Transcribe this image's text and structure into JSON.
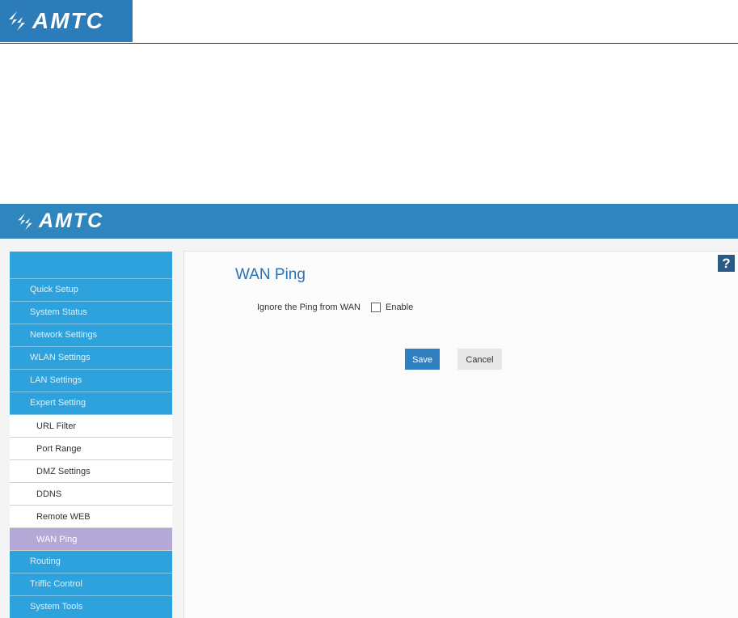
{
  "brand": {
    "logo_text": "AMTC",
    "color": "#2f86bf"
  },
  "sidebar": {
    "items": [
      {
        "label": "Quick Setup"
      },
      {
        "label": "System Status"
      },
      {
        "label": "Network Settings"
      },
      {
        "label": "WLAN Settings"
      },
      {
        "label": "LAN Settings"
      },
      {
        "label": "Expert Setting"
      }
    ],
    "sub_items": [
      {
        "label": "URL Filter"
      },
      {
        "label": "Port Range"
      },
      {
        "label": "DMZ Settings"
      },
      {
        "label": "DDNS"
      },
      {
        "label": "Remote WEB"
      },
      {
        "label": "WAN Ping",
        "active": true
      }
    ],
    "items_after": [
      {
        "label": "Routing"
      },
      {
        "label": "Triffic Control"
      },
      {
        "label": "System Tools"
      }
    ]
  },
  "main": {
    "title": "WAN Ping",
    "help_label": "?",
    "ignore_ping_label": "Ignore the Ping from WAN",
    "enable_label": "Enable",
    "enable_checked": false,
    "save_label": "Save",
    "cancel_label": "Cancel"
  },
  "colors": {
    "header": "#2f86bf",
    "menu": "#2ea2dc",
    "active_sub": "#b4a9d6",
    "title": "#2a72b3"
  }
}
